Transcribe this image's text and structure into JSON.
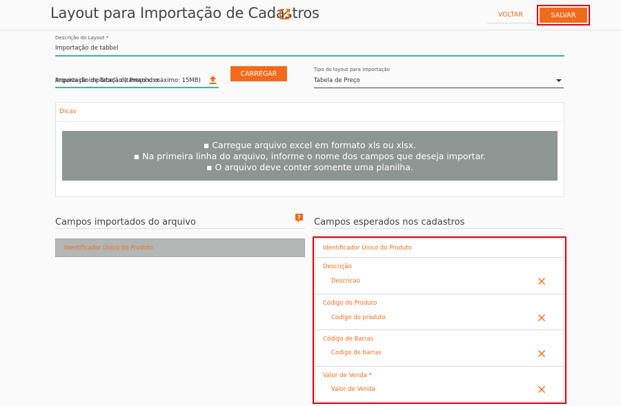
{
  "header": {
    "title": "Layout para Importação de Cadastros",
    "back_label": "VOLTAR",
    "save_label": "SALVAR"
  },
  "form": {
    "description_label": "Descrição do Layout *",
    "description_value": "Importação de tabbel",
    "file_label": "Importação de Tabela de Preço.xlsx",
    "file_hint": "Arquivo de importação (tamanho máximo: 15MB)",
    "upload_label": "CARREGAR",
    "layout_type_label": "Tipo do layout para importação",
    "layout_type_value": "Tabela de Preço"
  },
  "tips": {
    "title": "Dicas",
    "lines": [
      "▪ Carregue arquivo excel em formato xls ou xlsx.",
      "▪ Na primeira linha do arquivo, informe o nome dos campos que deseja importar.",
      "▪ O arquivo deve conter somente uma planilha."
    ]
  },
  "imported": {
    "title": "Campos importados do arquivo",
    "items": [
      {
        "label": "Identificador Único do Produto"
      }
    ]
  },
  "expected": {
    "title": "Campos esperados nos cadastros",
    "header_item": "Identificador Único do Produto",
    "items": [
      {
        "label": "Descrição",
        "value": "Descricao"
      },
      {
        "label": "Código do Produto",
        "value": "Codigo do produto"
      },
      {
        "label": "Código de Barras",
        "value": "Codigo de barras"
      },
      {
        "label": "Valor de Venda *",
        "value": "Valor de Venda"
      }
    ]
  },
  "icons": {
    "edit": "edit-external-icon",
    "upload": "upload-icon",
    "help": "help-icon",
    "remove": "close-icon",
    "caret": "caret-down-icon"
  },
  "colors": {
    "accent": "#f26a1b",
    "highlight_outline": "#d7000f",
    "underline_green": "#3fb39a",
    "tips_background": "#8d9693",
    "imported_item_background": "#b2b6b5"
  }
}
